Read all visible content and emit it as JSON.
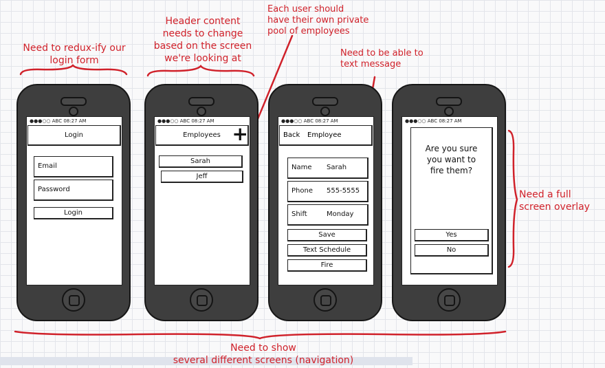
{
  "annotations": {
    "redux": [
      "Need to redux-ify our",
      "login form"
    ],
    "header": [
      "Header content",
      "needs to change",
      "based on the screen",
      "we're looking at"
    ],
    "pool": [
      "Each user should",
      "have their own private",
      "pool of employees"
    ],
    "text": [
      "Need to be able to",
      "text message"
    ],
    "overlay": [
      "Need a full",
      "screen overlay"
    ],
    "nav": [
      "Need to show",
      "several different screens (navigation)"
    ]
  },
  "status_bar": "●●●○○ ABC 08:27 AM",
  "screens": {
    "login": {
      "title": "Login",
      "email_label": "Email",
      "password_label": "Password",
      "login_button": "Login"
    },
    "employees": {
      "title": "Employees",
      "add_icon": "plus-icon",
      "items": [
        "Sarah",
        "Jeff"
      ]
    },
    "employee": {
      "back": "Back",
      "title": "Employee",
      "fields": [
        {
          "label": "Name",
          "value": "Sarah"
        },
        {
          "label": "Phone",
          "value": "555-5555"
        },
        {
          "label": "Shift",
          "value": "Monday"
        }
      ],
      "save": "Save",
      "text_schedule": "Text Schedule",
      "fire": "Fire"
    },
    "confirm": {
      "message": [
        "Are you sure",
        "you want to",
        "fire them?"
      ],
      "yes": "Yes",
      "no": "No"
    }
  },
  "colors": {
    "annotation": "#d0212a",
    "phone_body": "#3e3e3e"
  }
}
